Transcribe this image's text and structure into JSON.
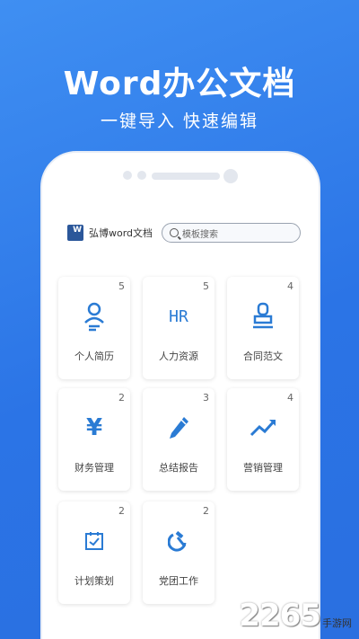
{
  "hero": {
    "title": "Word办公文档",
    "subtitle": "一键导入 快速编辑"
  },
  "app": {
    "logo_letter": "W",
    "name": "弘博word文档",
    "search_placeholder": "模板搜索"
  },
  "categories": [
    {
      "label": "个人简历",
      "count": "5",
      "icon": "person-resume-icon"
    },
    {
      "label": "人力资源",
      "count": "5",
      "icon": "hr-icon"
    },
    {
      "label": "合同范文",
      "count": "4",
      "icon": "stamp-icon"
    },
    {
      "label": "财务管理",
      "count": "2",
      "icon": "yen-icon"
    },
    {
      "label": "总结报告",
      "count": "3",
      "icon": "pencil-icon"
    },
    {
      "label": "营销管理",
      "count": "4",
      "icon": "trend-chart-icon"
    },
    {
      "label": "计划策划",
      "count": "2",
      "icon": "calendar-check-icon"
    },
    {
      "label": "党团工作",
      "count": "2",
      "icon": "hammer-sickle-icon"
    }
  ],
  "icon_text": {
    "hr": "HR"
  },
  "colors": {
    "background": "#2b74e6",
    "icon": "#2a7bd4"
  },
  "watermark": {
    "number": "2265",
    "site": "手游网"
  }
}
